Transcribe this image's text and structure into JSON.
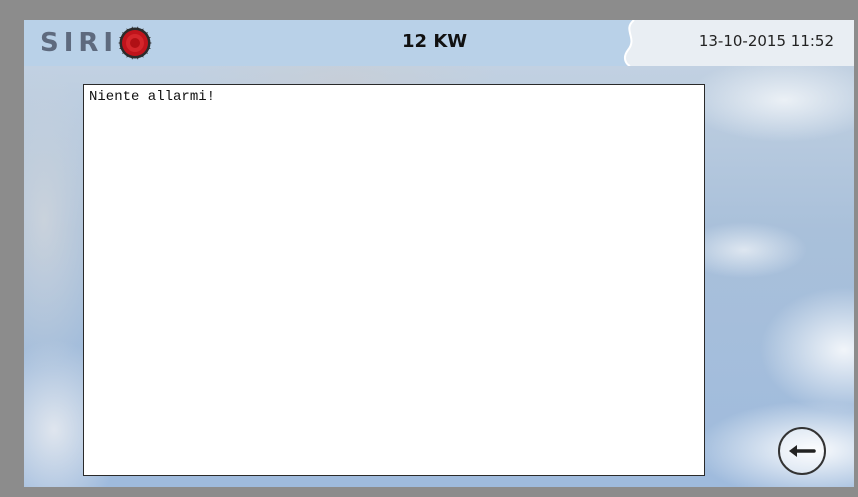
{
  "header": {
    "logo_text": "SIRI",
    "power": "12 KW",
    "datetime": "13-10-2015 11:52"
  },
  "alarms": {
    "message": "Niente allarmi!"
  },
  "controls": {
    "back_icon": "arrow-left-icon"
  },
  "colors": {
    "header_bg": "#b9d1e8",
    "datetime_bg": "#e9eef3",
    "logo_sun": "#c0141c",
    "frame": "#8c8c8c"
  }
}
